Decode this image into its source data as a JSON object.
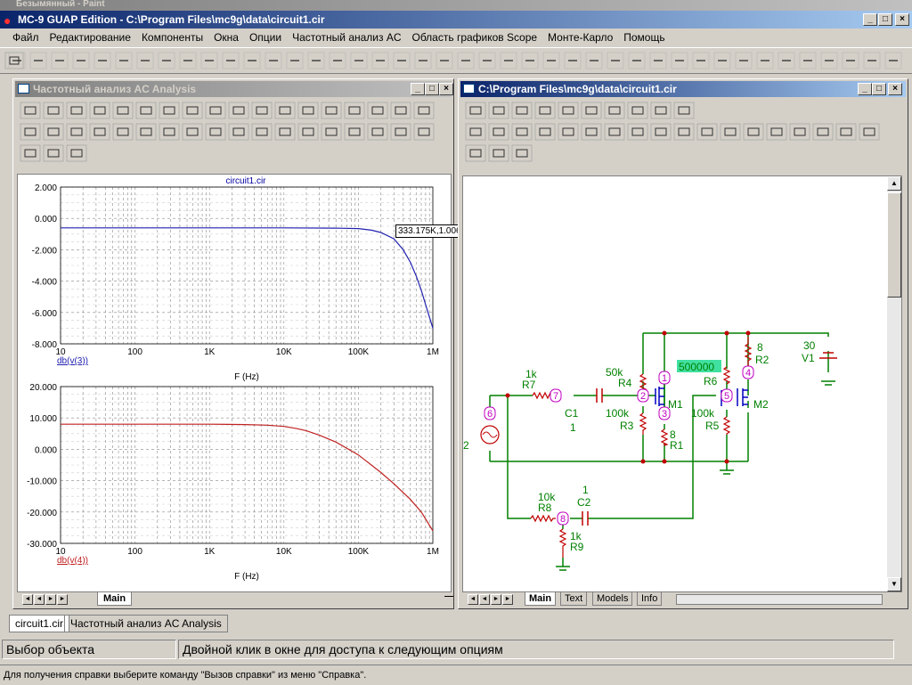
{
  "bg_title": "Безымянный - Paint",
  "app": {
    "title": "MC-9 GUAP Edition - C:\\Program Files\\mc9g\\data\\circuit1.cir"
  },
  "menu": [
    "Файл",
    "Редактирование",
    "Компоненты",
    "Окна",
    "Опции",
    "Частотный анализ AC",
    "Область графиков Scope",
    "Монте-Карло",
    "Помощь"
  ],
  "analysis_window": {
    "title": "Частотный анализ AC Analysis",
    "plot_title": "circuit1.cir",
    "tooltip": "333.175K,1.006",
    "xlabel": "F (Hz)",
    "tab": "Main"
  },
  "schematic_window": {
    "title": "C:\\Program Files\\mc9g\\data\\circuit1.cir",
    "tabs": [
      "Main",
      "Text",
      "Models",
      "Info"
    ]
  },
  "schematic": {
    "R1": "R1",
    "R1v": "8",
    "R2": "R2",
    "R2v": "8",
    "R3": "R3",
    "R3v": "100k",
    "R4": "R4",
    "R4v": "50k",
    "R5": "R5",
    "R5v": "100k",
    "R6": "R6",
    "R6v": "500000",
    "R7": "R7",
    "R7v": "1k",
    "R8": "R8",
    "R8v": "10k",
    "R9": "R9",
    "R9v": "1k",
    "C1": "C1",
    "C1v": "1",
    "C2": "C2",
    "C2v": "1",
    "M1": "M1",
    "M2": "M2",
    "V1": "V1",
    "V1v": "30",
    "V2": "2",
    "nodes": [
      "1",
      "2",
      "3",
      "4",
      "5",
      "6",
      "7",
      "8"
    ]
  },
  "doc_tabs": [
    "circuit1.cir",
    "Частотный анализ AC Analysis"
  ],
  "status": {
    "left": "Выбор объекта",
    "right": "Двойной клик в окне для доступа к следующим опциям"
  },
  "help": "Для получения справки выберите команду \"Вызов справки\" из меню \"Справка\".",
  "colors": {
    "trace1": "#2020b0",
    "trace2": "#c02020",
    "wire": "#008000",
    "node": "#c000c0",
    "highlight": "#40e0a0"
  },
  "chart_data": [
    {
      "type": "line",
      "title": "circuit1.cir",
      "xlabel": "F (Hz)",
      "x_scale": "log",
      "xlim": [
        10,
        1000000
      ],
      "x_ticks": [
        "10",
        "100",
        "1K",
        "10K",
        "100K",
        "1M"
      ],
      "ylim": [
        -8,
        2
      ],
      "y_ticks": [
        "2.000",
        "0.000",
        "-2.000",
        "-4.000",
        "-6.000",
        "-8.000"
      ],
      "grid": true,
      "series": [
        {
          "name": "db(v(3))",
          "color": "#2020b0",
          "x": [
            10,
            1000,
            10000,
            50000,
            100000,
            150000,
            200000,
            300000,
            400000,
            500000,
            600000,
            700000,
            800000,
            900000,
            1000000
          ],
          "y": [
            -0.6,
            -0.6,
            -0.6,
            -0.62,
            -0.65,
            -0.75,
            -0.9,
            -1.3,
            -2.0,
            -2.8,
            -3.7,
            -4.6,
            -5.5,
            -6.3,
            -7.0
          ]
        }
      ]
    },
    {
      "type": "line",
      "xlabel": "F (Hz)",
      "x_scale": "log",
      "xlim": [
        10,
        1000000
      ],
      "x_ticks": [
        "10",
        "100",
        "1K",
        "10K",
        "100K",
        "1M"
      ],
      "ylim": [
        -30,
        20
      ],
      "y_ticks": [
        "20.000",
        "10.000",
        "0.000",
        "-10.000",
        "-20.000",
        "-30.000"
      ],
      "grid": true,
      "series": [
        {
          "name": "db(v(4))",
          "color": "#c02020",
          "x": [
            10,
            100,
            1000,
            3000,
            6000,
            10000,
            15000,
            20000,
            30000,
            50000,
            100000,
            200000,
            300000,
            500000,
            700000,
            1000000
          ],
          "y": [
            8,
            8,
            8,
            7.9,
            7.7,
            7.3,
            6.6,
            5.9,
            4.5,
            2.3,
            -1.8,
            -7.4,
            -11,
            -16,
            -20,
            -26
          ]
        }
      ]
    }
  ]
}
